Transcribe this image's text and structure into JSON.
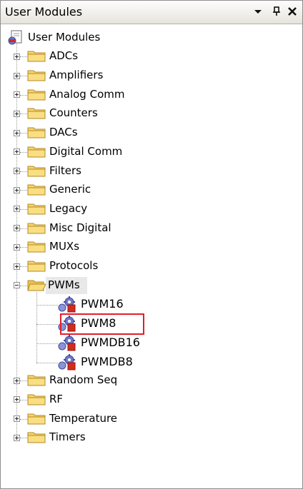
{
  "panel": {
    "title": "User Modules",
    "buttons": {
      "dropdown_icon": "chevron-down-icon",
      "pin_icon": "pin-icon",
      "close_icon": "close-icon"
    }
  },
  "tree": {
    "root_label": "User Modules",
    "folders": [
      {
        "label": "ADCs"
      },
      {
        "label": "Amplifiers"
      },
      {
        "label": "Analog Comm"
      },
      {
        "label": "Counters"
      },
      {
        "label": "DACs"
      },
      {
        "label": "Digital Comm"
      },
      {
        "label": "Filters"
      },
      {
        "label": "Generic"
      },
      {
        "label": "Legacy"
      },
      {
        "label": "Misc Digital"
      },
      {
        "label": "MUXs"
      },
      {
        "label": "Protocols"
      },
      {
        "label": "PWMs",
        "expanded": true,
        "children": [
          "PWM16",
          "PWM8",
          "PWMDB16",
          "PWMDB8"
        ]
      },
      {
        "label": "Random Seq"
      },
      {
        "label": "RF"
      },
      {
        "label": "Temperature"
      },
      {
        "label": "Timers"
      }
    ],
    "highlighted_module": "PWM8",
    "colors": {
      "highlight_border": "#e1202a",
      "folder": "#f6d46a",
      "module_gear": "#6f77c8",
      "module_block": "#d22b1f"
    }
  }
}
